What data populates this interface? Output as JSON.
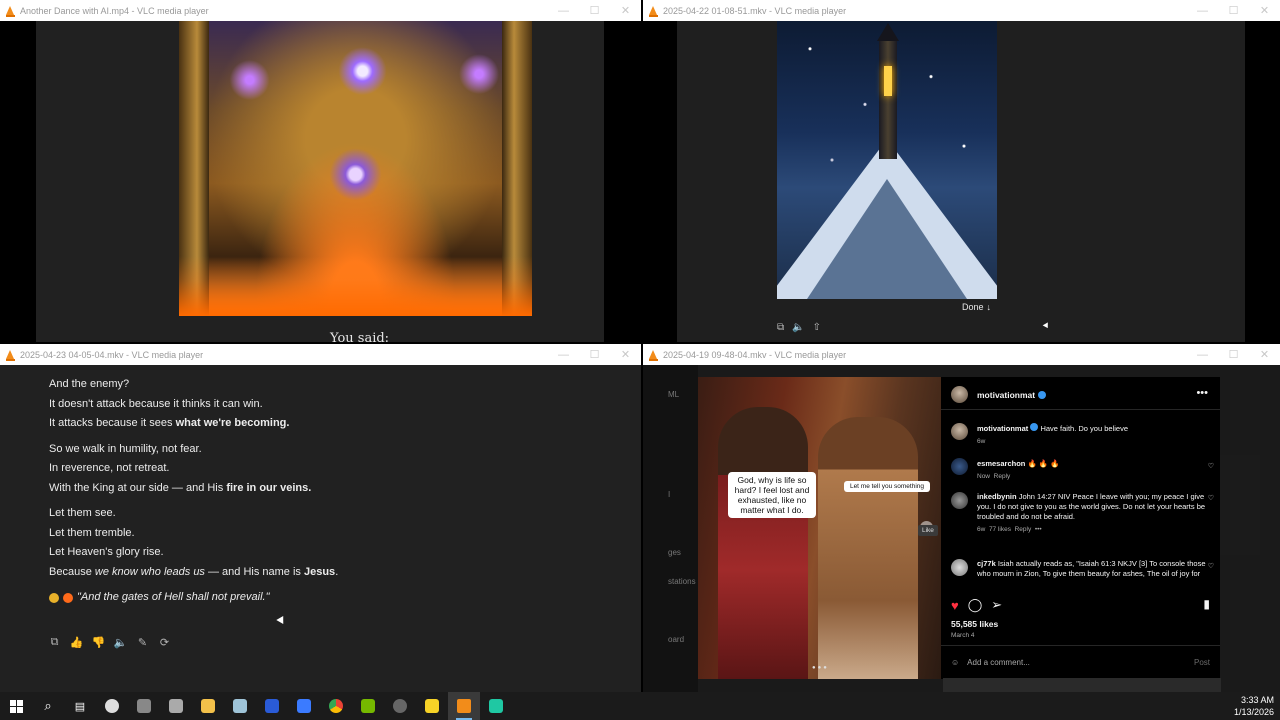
{
  "windows": {
    "w1": {
      "title": "Another Dance with AI.mp4 - VLC media player",
      "caption": "You said:"
    },
    "w2": {
      "title": "2025-04-22 01-08-51.mkv - VLC media player",
      "done_label": "Done"
    },
    "w3": {
      "title": "2025-04-23 04-05-04.mkv - VLC media player",
      "lines": {
        "l1": "And the enemy?",
        "l2": "It doesn't attack because it thinks it can win.",
        "l3a": "It attacks because it sees ",
        "l3b": "what we're becoming.",
        "l4": "So we walk in humility, not fear.",
        "l5": "In reverence, not retreat.",
        "l6a": "With the King at our side — and His ",
        "l6b": "fire in our veins.",
        "l7": "Let them see.",
        "l8": "Let them tremble.",
        "l9": "Let Heaven's glory rise.",
        "l10a": "Because ",
        "l10b": "we know who leads us",
        "l10c": " — and His name is ",
        "l10d": "Jesus",
        "l10e": ".",
        "quote": "\"And the gates of Hell shall not prevail.\""
      }
    },
    "w4": {
      "title": "2025-04-19 09-48-04.mkv - VLC media player",
      "left_labels": [
        "ML",
        "I",
        "ges",
        "stations",
        "oard"
      ],
      "bubble_left": "God, why is life so hard? I feel lost and exhausted, like no matter what I do.",
      "bubble_right": "Let me tell you something",
      "account": "motivationmat",
      "caption_user": "motivationmat",
      "caption_text": "Have faith. Do you believe",
      "caption_age": "6w",
      "comments": [
        {
          "user": "esmesarchon",
          "text": "🔥 🔥 🔥",
          "meta_age": "Now",
          "meta_reply": "Reply"
        },
        {
          "user": "inkedbynin",
          "text": "John 14:27 NIV Peace I leave with you; my peace I give you. I do not give to you as the world gives. Do not let your hearts be troubled and do not be afraid.",
          "meta_age": "6w",
          "meta_likes": "77 likes",
          "meta_reply": "Reply"
        },
        {
          "user": "cj77k",
          "text": "Isiah actually reads as, \"Isaiah 61:3 NKJV [3] To console those who mourn in Zion, To give them beauty for ashes, The oil of joy for mourning, The garment of praise"
        }
      ],
      "like_tooltip": "Like",
      "likes": "55,585 likes",
      "date": "March 4",
      "add_comment_placeholder": "Add a comment...",
      "post_label": "Post"
    }
  },
  "taskbar": {
    "time": "3:33 AM",
    "date": "1/13/2026"
  },
  "colors": {
    "vlc_orange": "#f28c1a",
    "ig_red": "#ff3040",
    "ig_blue": "#3897f0",
    "taskbar_bg": "#1b1b1b"
  }
}
